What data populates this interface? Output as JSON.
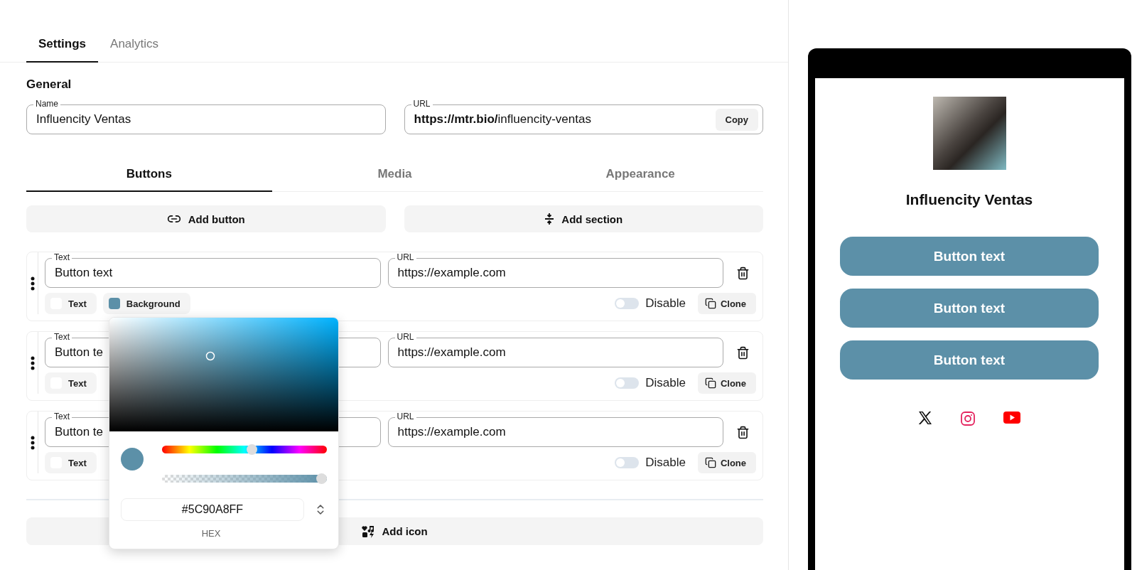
{
  "tabs": [
    {
      "label": "Settings",
      "selected": true
    },
    {
      "label": "Analytics",
      "selected": false
    }
  ],
  "general": {
    "heading": "General",
    "name_field": {
      "label": "Name",
      "value": "Influencity Ventas"
    },
    "url_field": {
      "label": "URL",
      "value": "**https://mtr.bio/**influencity-ventas",
      "copy_label": "Copy"
    }
  },
  "subtabs": [
    {
      "label": "Buttons",
      "selected": true
    },
    {
      "label": "Media",
      "selected": false
    },
    {
      "label": "Appearance",
      "selected": false
    }
  ],
  "actions": [
    {
      "kind": "link",
      "label": "Add button"
    },
    {
      "kind": "section",
      "label": "Add section"
    }
  ],
  "button_rows": [
    {
      "text_label": "Text",
      "text_value": "Button text",
      "url_label": "URL",
      "url_value": "https://example.com",
      "swatches": [
        {
          "label": "Text",
          "color": "#ffffff"
        },
        {
          "label": "Background",
          "color": "#5c90a8"
        }
      ],
      "disable_label": "Disable",
      "on": false,
      "clone_label": "Clone"
    },
    {
      "text_label": "Text",
      "text_value": "Button te",
      "url_label": "URL",
      "url_value": "https://example.com",
      "swatches": [
        {
          "label": "Text",
          "color": "#ffffff"
        }
      ],
      "disable_label": "Disable",
      "on": false,
      "clone_label": "Clone"
    },
    {
      "text_label": "Text",
      "text_value": "Button te",
      "url_label": "URL",
      "url_value": "https://example.com",
      "swatches": [
        {
          "label": "Text",
          "color": "#ffffff"
        }
      ],
      "disable_label": "Disable",
      "on": false,
      "clone_label": "Clone"
    }
  ],
  "add_icon": {
    "label": "Add icon"
  },
  "color_picker": {
    "hue": {
      "level": 0.55
    },
    "alpha": {
      "level": 1
    },
    "hex": "#5C90A8FF",
    "format_label": "HEX"
  },
  "preview": {
    "name": "Influencity Ventas",
    "buttons": [
      "Button text",
      "Button text",
      "Button text"
    ],
    "socials": [
      {
        "kind": "x"
      },
      {
        "kind": "instagram"
      },
      {
        "kind": "youtube"
      }
    ]
  }
}
